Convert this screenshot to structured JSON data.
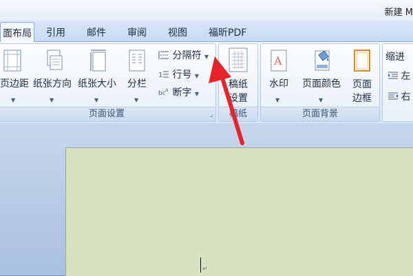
{
  "window": {
    "title": "新建 M"
  },
  "tabs": [
    {
      "label": "面布局",
      "active": true
    },
    {
      "label": "引用"
    },
    {
      "label": "邮件"
    },
    {
      "label": "审阅"
    },
    {
      "label": "视图"
    },
    {
      "label": "福昕PDF"
    }
  ],
  "groups": {
    "page_setup": {
      "label": "页面设置",
      "margins": "页边距",
      "orientation": "纸张方向",
      "size": "纸张大小",
      "columns": "分栏",
      "breaks": "分隔符",
      "line_numbers": "行号",
      "hyphenation": "断字"
    },
    "manuscript": {
      "label": "稿纸",
      "button_line1": "稿纸",
      "button_line2": "设置"
    },
    "page_background": {
      "label": "页面背景",
      "watermark": "水印",
      "page_color": "页面颜色",
      "page_borders_line1": "页面",
      "page_borders_line2": "边框"
    },
    "paragraph": {
      "indent_label": "缩进",
      "left": "左",
      "right": "右"
    }
  },
  "colors": {
    "arrow": "#e8232a",
    "page_background": "#d6e2c0",
    "ribbon_border": "#b7cbe7"
  }
}
